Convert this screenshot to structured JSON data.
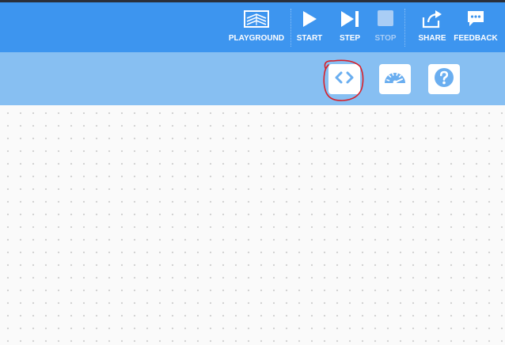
{
  "toolbar": {
    "buttons": [
      {
        "label": "PLAYGROUND",
        "icon": "playground-icon",
        "enabled": true
      },
      {
        "label": "START",
        "icon": "play-icon",
        "enabled": true
      },
      {
        "label": "STEP",
        "icon": "step-icon",
        "enabled": true
      },
      {
        "label": "STOP",
        "icon": "stop-icon",
        "enabled": false
      },
      {
        "label": "SHARE",
        "icon": "share-icon",
        "enabled": true
      },
      {
        "label": "FEEDBACK",
        "icon": "feedback-icon",
        "enabled": true
      }
    ]
  },
  "subbar": {
    "buttons": [
      {
        "icon": "code-icon"
      },
      {
        "icon": "speedometer-icon"
      },
      {
        "icon": "help-icon"
      }
    ]
  },
  "annotation": {
    "shape": "hand-drawn circle",
    "target": "code-icon",
    "color": "#d8202a"
  },
  "colors": {
    "toolbar": "#3d95ef",
    "subbar": "#87bff2",
    "canvas": "#fafafa",
    "icon_accent": "#6aaef0",
    "disabled": "#a9cdf5"
  }
}
